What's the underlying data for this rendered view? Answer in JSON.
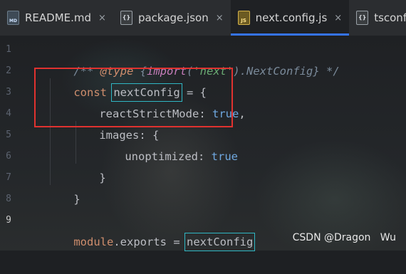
{
  "tabs": [
    {
      "label": "README.md",
      "icon": "markdown-file-icon",
      "badge": "MD",
      "active": false,
      "closable": true
    },
    {
      "label": "package.json",
      "icon": "json-file-icon",
      "badge": "{}",
      "active": false,
      "closable": true
    },
    {
      "label": "next.config.js",
      "icon": "javascript-file-icon",
      "badge": "JS",
      "active": true,
      "closable": true
    },
    {
      "label": "tsconfig.j",
      "icon": "json-file-icon",
      "badge": "{}",
      "active": false,
      "closable": false
    }
  ],
  "close_glyph": "×",
  "line_numbers": [
    "1",
    "2",
    "3",
    "4",
    "5",
    "6",
    "7",
    "8",
    "9"
  ],
  "current_line": "9",
  "code": {
    "l1_open": "/** ",
    "l1_annotation": "@type",
    "l1_type_open": " {",
    "l1_import": "import",
    "l1_paren_open": "(",
    "l1_string": "'next'",
    "l1_rest": ").NextConfig} */",
    "l2_kw": "const",
    "l2_ident": "nextConfig",
    "l2_rest": " = {",
    "l3_prop": "reactStrictMode",
    "l3_colon": ": ",
    "l3_value": "true",
    "l3_comma": ",",
    "l4_prop": "images",
    "l4_rest": ": {",
    "l5_prop": "unoptimized",
    "l5_colon": ": ",
    "l5_value": "true",
    "l6_brace": "}",
    "l7_brace": "}",
    "l9_module": "module",
    "l9_dot": ".",
    "l9_exports": "exports",
    "l9_eq": " = ",
    "l9_ident": "nextConfig"
  },
  "watermark": "CSDN @Dragon   Wu",
  "colors": {
    "keyword": "#cf8e6d",
    "string": "#6aab73",
    "boolean": "#6fa8e0",
    "highlight_box": "#e0322f",
    "identifier_box": "#2fb7c4",
    "active_tab_underline": "#3574f0"
  }
}
